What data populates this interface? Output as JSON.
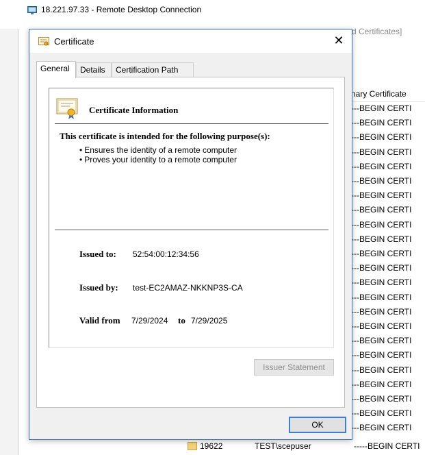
{
  "remote_desktop": {
    "title": "18.221.97.33 - Remote Desktop Connection"
  },
  "background_window": {
    "title_suffix": "d Certificates]",
    "column_header": "nary Certificate",
    "rows": [
      "---BEGIN CERTI",
      "---BEGIN CERTI",
      "---BEGIN CERTI",
      "---BEGIN CERTI",
      "---BEGIN CERTI",
      "---BEGIN CERTI",
      "---BEGIN CERTI",
      "---BEGIN CERTI",
      "---BEGIN CERTI",
      "---BEGIN CERTI",
      "---BEGIN CERTI",
      "---BEGIN CERTI",
      "---BEGIN CERTI",
      "---BEGIN CERTI",
      "---BEGIN CERTI",
      "---BEGIN CERTI",
      "---BEGIN CERTI",
      "---BEGIN CERTI",
      "---BEGIN CERTI",
      "---BEGIN CERTI",
      "---BEGIN CERTI",
      "---BEGIN CERTI",
      "---BEGIN CERTI"
    ],
    "bottom_row": {
      "id": "19622",
      "user": "TEST\\scepuser",
      "cert": "-----BEGIN CERTI"
    }
  },
  "dialog": {
    "title": "Certificate",
    "close_glyph": "✕",
    "tabs": [
      {
        "label": "General",
        "active": true
      },
      {
        "label": "Details",
        "active": false
      },
      {
        "label": "Certification Path",
        "active": false
      }
    ],
    "info_title": "Certificate Information",
    "purpose_heading": "This certificate is intended for the following purpose(s):",
    "purposes": [
      "Ensures the identity of a remote computer",
      "Proves your identity to a remote computer"
    ],
    "issued_to_label": "Issued to:",
    "issued_to_value": "52:54:00:12:34:56",
    "issued_by_label": "Issued by:",
    "issued_by_value": "test-EC2AMAZ-NKKNP3S-CA",
    "valid_from_label": "Valid from",
    "valid_from_value": "7/29/2024",
    "valid_to_label": "to",
    "valid_to_value": "7/29/2025",
    "issuer_statement_label": "Issuer Statement",
    "ok_label": "OK"
  },
  "colors": {
    "dialog_border": "#2f6fbd",
    "ok_focus": "#3c7fd3",
    "disabled_text": "#8d8d8d"
  },
  "icons": {
    "remote_desktop": "remote-desktop-icon",
    "certificate_small": "certificate-icon",
    "certificate_large": "certificate-info-icon"
  }
}
